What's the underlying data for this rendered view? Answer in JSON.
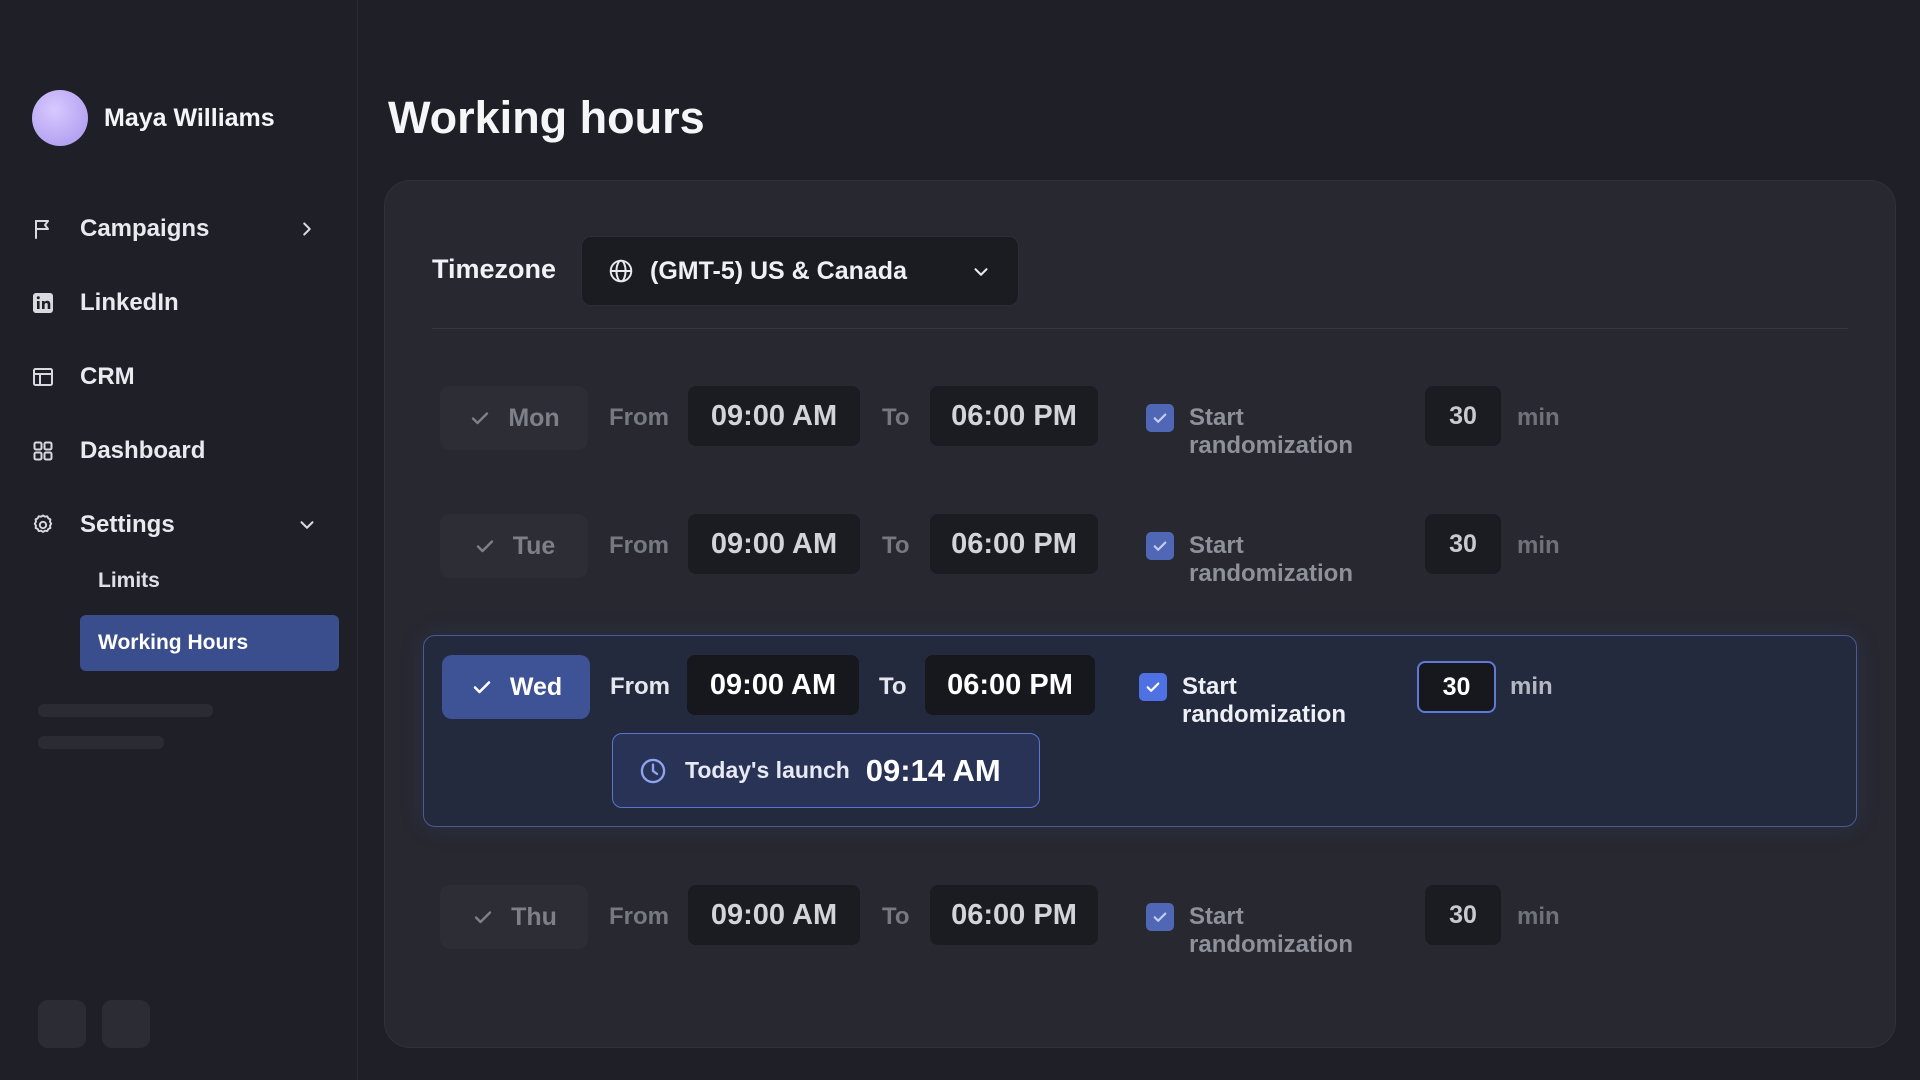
{
  "user": {
    "name": "Maya Williams"
  },
  "sidebar": {
    "items": [
      {
        "label": "Campaigns"
      },
      {
        "label": "LinkedIn"
      },
      {
        "label": "CRM"
      },
      {
        "label": "Dashboard"
      },
      {
        "label": "Settings"
      }
    ],
    "settings_sub": [
      {
        "label": "Limits"
      },
      {
        "label": "Working Hours"
      }
    ]
  },
  "page": {
    "title": "Working hours"
  },
  "timezone": {
    "label": "Timezone",
    "value": "(GMT-5) US & Canada"
  },
  "days": [
    {
      "day": "Mon",
      "from_label": "From",
      "from": "09:00 AM",
      "to_label": "To",
      "to": "06:00 PM",
      "rand_label": "Start randomization",
      "rand_value": "30",
      "unit": "min"
    },
    {
      "day": "Tue",
      "from_label": "From",
      "from": "09:00 AM",
      "to_label": "To",
      "to": "06:00 PM",
      "rand_label": "Start randomization",
      "rand_value": "30",
      "unit": "min"
    },
    {
      "day": "Wed",
      "from_label": "From",
      "from": "09:00 AM",
      "to_label": "To",
      "to": "06:00 PM",
      "rand_label": "Start randomization",
      "rand_value": "30",
      "unit": "min"
    },
    {
      "day": "Thu",
      "from_label": "From",
      "from": "09:00 AM",
      "to_label": "To",
      "to": "06:00 PM",
      "rand_label": "Start randomization",
      "rand_value": "30",
      "unit": "min"
    }
  ],
  "launch": {
    "label": "Today's launch",
    "time": "09:14 AM"
  },
  "colors": {
    "accent": "#3e5395",
    "checkbox": "#4e72e4",
    "background": "#1f2027",
    "card": "#272830"
  }
}
